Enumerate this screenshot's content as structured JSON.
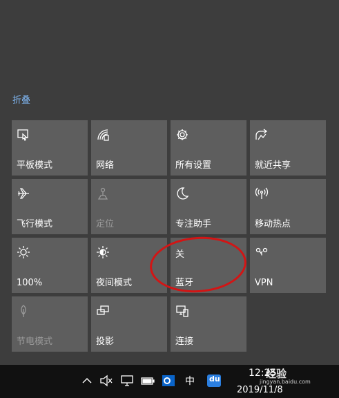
{
  "action_center": {
    "collapse_label": "折叠",
    "tiles": [
      {
        "label": "平板模式",
        "icon": "tablet-mode-icon",
        "enabled": true
      },
      {
        "label": "网络",
        "icon": "network-icon",
        "enabled": true
      },
      {
        "label": "所有设置",
        "icon": "gear-icon",
        "enabled": true
      },
      {
        "label": "就近共享",
        "icon": "share-icon",
        "enabled": true
      },
      {
        "label": "飞行模式",
        "icon": "airplane-icon",
        "enabled": true
      },
      {
        "label": "定位",
        "icon": "location-icon",
        "enabled": false
      },
      {
        "label": "专注助手",
        "icon": "moon-icon",
        "enabled": true
      },
      {
        "label": "移动热点",
        "icon": "hotspot-icon",
        "enabled": true
      },
      {
        "label": "100%",
        "icon": "brightness-icon",
        "enabled": true
      },
      {
        "label": "夜间模式",
        "icon": "night-light-icon",
        "enabled": true
      },
      {
        "label": "蓝牙",
        "status": "关",
        "enabled": true
      },
      {
        "label": "VPN",
        "icon": "vpn-icon",
        "enabled": true
      },
      {
        "label": "节电模式",
        "icon": "leaf-icon",
        "enabled": false
      },
      {
        "label": "投影",
        "icon": "project-icon",
        "enabled": true
      },
      {
        "label": "连接",
        "icon": "connect-icon",
        "enabled": true
      }
    ]
  },
  "taskbar": {
    "ime_label": "中",
    "baidu_label": "du",
    "time": "12:25",
    "date": "2019/11/8",
    "watermark": "经验",
    "watermark_sub": "jingyan.baidu.com"
  },
  "colors": {
    "panel_bg": "#3d3d3d",
    "tile_bg": "#5e5e5e",
    "accent_link": "#7fb6f2",
    "annotation_circle": "#d21515",
    "taskbar_bg": "#111111"
  }
}
